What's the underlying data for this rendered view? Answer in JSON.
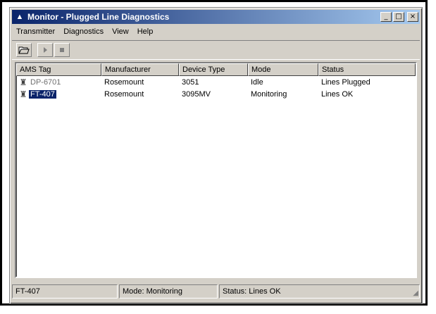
{
  "window": {
    "title": "Monitor - Plugged Line Diagnostics",
    "controls": {
      "minimize": "_",
      "maximize": "□",
      "close": "×"
    }
  },
  "menu": [
    {
      "label": "Transmitter"
    },
    {
      "label": "Diagnostics"
    },
    {
      "label": "View"
    },
    {
      "label": "Help"
    }
  ],
  "toolbar": {
    "open_icon": "open-folder-icon",
    "start_icon": "play-icon",
    "stop_icon": "stop-icon"
  },
  "list": {
    "columns": [
      "AMS Tag",
      "Manufacturer",
      "Device Type",
      "Mode",
      "Status"
    ],
    "rows": [
      {
        "tag": "DP-6701",
        "manufacturer": "Rosemount",
        "device_type": "3051",
        "mode": "Idle",
        "status": "Lines Plugged",
        "selected": false
      },
      {
        "tag": "FT-407",
        "manufacturer": "Rosemount",
        "device_type": "3095MV",
        "mode": "Monitoring",
        "status": "Lines OK",
        "selected": true
      }
    ]
  },
  "statusbar": {
    "device": "FT-407",
    "mode": "Mode: Monitoring",
    "status": "Status: Lines OK"
  },
  "colors": {
    "titlebar": "#0a246a",
    "selection": "#0a246a",
    "chrome": "#d4d0c8"
  }
}
